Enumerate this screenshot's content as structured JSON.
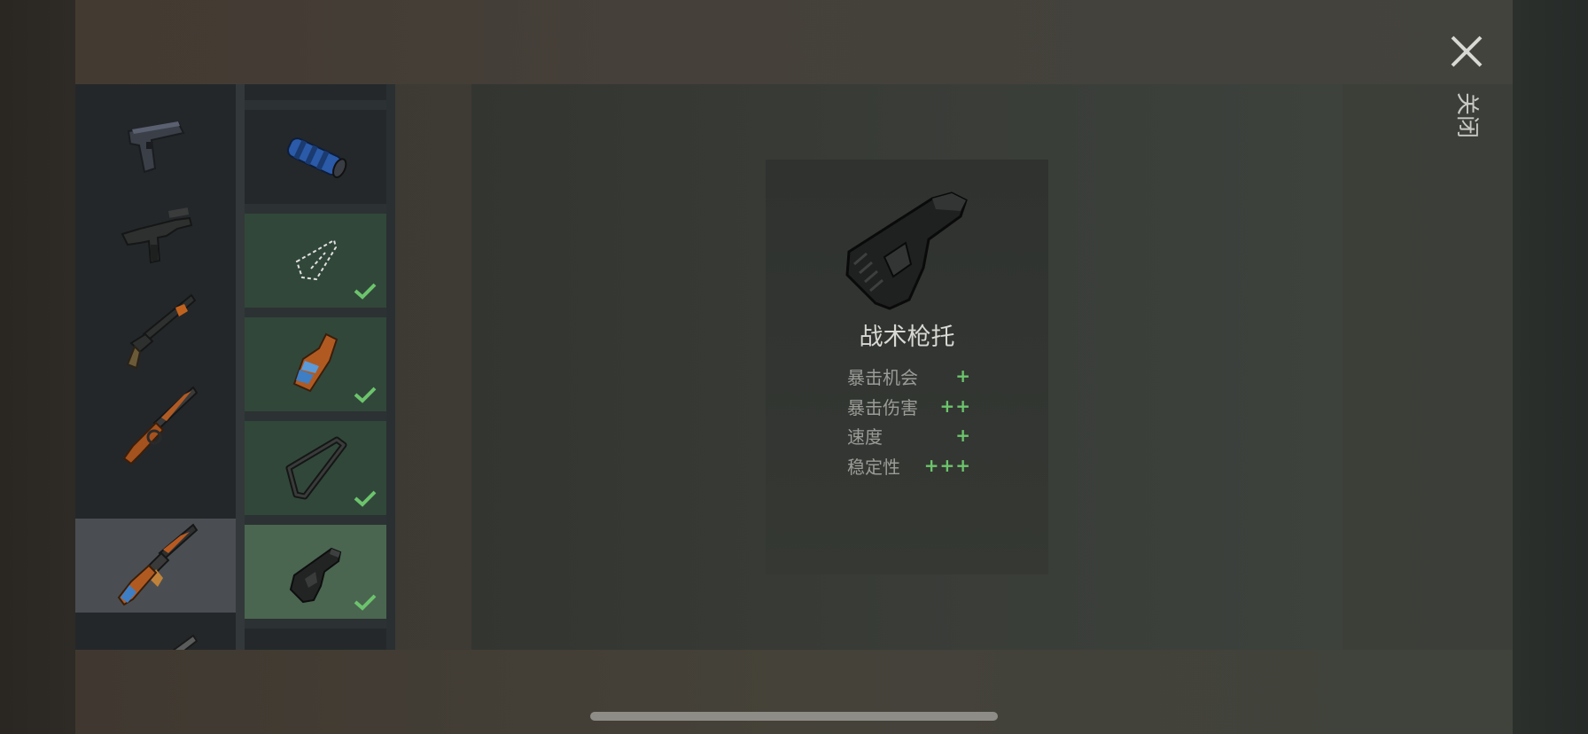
{
  "close": {
    "label": "关闭",
    "icon": "close-icon"
  },
  "weapons": [
    {
      "icon": "pistol-icon",
      "selected": false
    },
    {
      "icon": "uzi-icon",
      "selected": false
    },
    {
      "icon": "shotgun-icon",
      "selected": false
    },
    {
      "icon": "lever-rifle-icon",
      "selected": false
    },
    {
      "icon": "ak-rifle-icon",
      "selected": true
    },
    {
      "icon": "rifle-partial-icon",
      "selected": false
    }
  ],
  "attachments": [
    {
      "icon": "suppressor-icon",
      "equipped": false
    },
    {
      "icon": "empty-stock-outline-icon",
      "equipped": true
    },
    {
      "icon": "wooden-stock-icon",
      "equipped": true
    },
    {
      "icon": "skeleton-stock-icon",
      "equipped": true
    },
    {
      "icon": "tactical-stock-icon",
      "equipped": true,
      "selected": true
    }
  ],
  "detail": {
    "icon": "tactical-stock-icon",
    "name": "战术枪托",
    "stats": [
      {
        "label": "暴击机会",
        "value": "+"
      },
      {
        "label": "暴击伤害",
        "value": "++"
      },
      {
        "label": "速度",
        "value": "+"
      },
      {
        "label": "稳定性",
        "value": "+++"
      }
    ]
  },
  "colors": {
    "accent_green": "#6cc46c",
    "slot_green": "#31473a",
    "slot_selected": "#4a6550",
    "weapon_selected": "#4a4e52"
  }
}
